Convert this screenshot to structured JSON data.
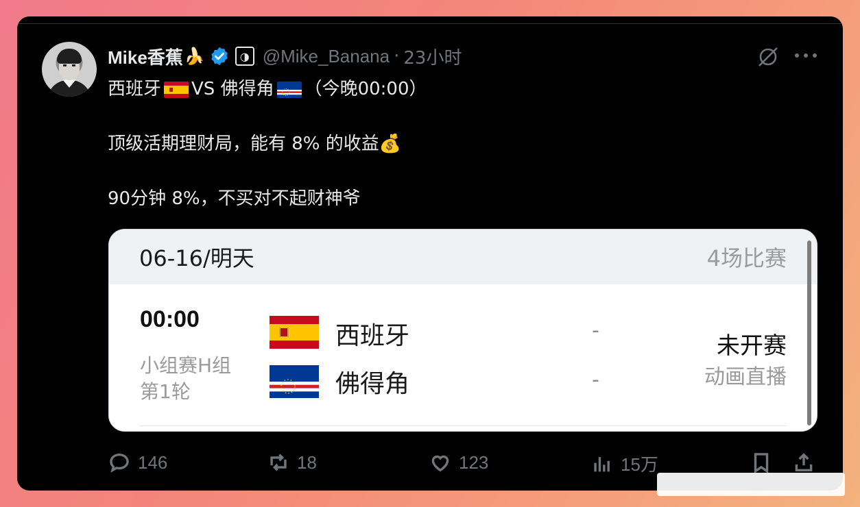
{
  "tweet": {
    "author_name": "Mike香蕉",
    "author_emoji": "🍌",
    "handle": "@Mike_Banana",
    "time": "23小时",
    "line1_part1": "西班牙",
    "line1_vs": "VS 佛得角",
    "line1_time": "（今晚00:00）",
    "line2": "顶级活期理财局，能有 8% 的收益",
    "line2_emoji": "💰",
    "line3": "90分钟 8%，不买对不起财神爷"
  },
  "embed": {
    "date": "06-16/明天",
    "count": "4场比赛",
    "match_time": "00:00",
    "stage_line1": "小组赛H组",
    "stage_line2": "第1轮",
    "home_team": "西班牙",
    "away_team": "佛得角",
    "home_score": "-",
    "away_score": "-",
    "status": "未开赛",
    "live": "动画直播"
  },
  "actions": {
    "replies": "146",
    "reposts": "18",
    "likes": "123",
    "views": "15万"
  },
  "colors": {
    "background_gradient": [
      "#f07a8a",
      "#f3b27e"
    ],
    "card": "#000000",
    "verified": "#1d9bf0",
    "muted": "#71767b"
  },
  "icons": [
    "verified-badge-icon",
    "affiliate-badge-icon",
    "grok-icon",
    "more-icon",
    "reply-icon",
    "repost-icon",
    "like-icon",
    "views-icon",
    "bookmark-icon",
    "share-icon"
  ]
}
